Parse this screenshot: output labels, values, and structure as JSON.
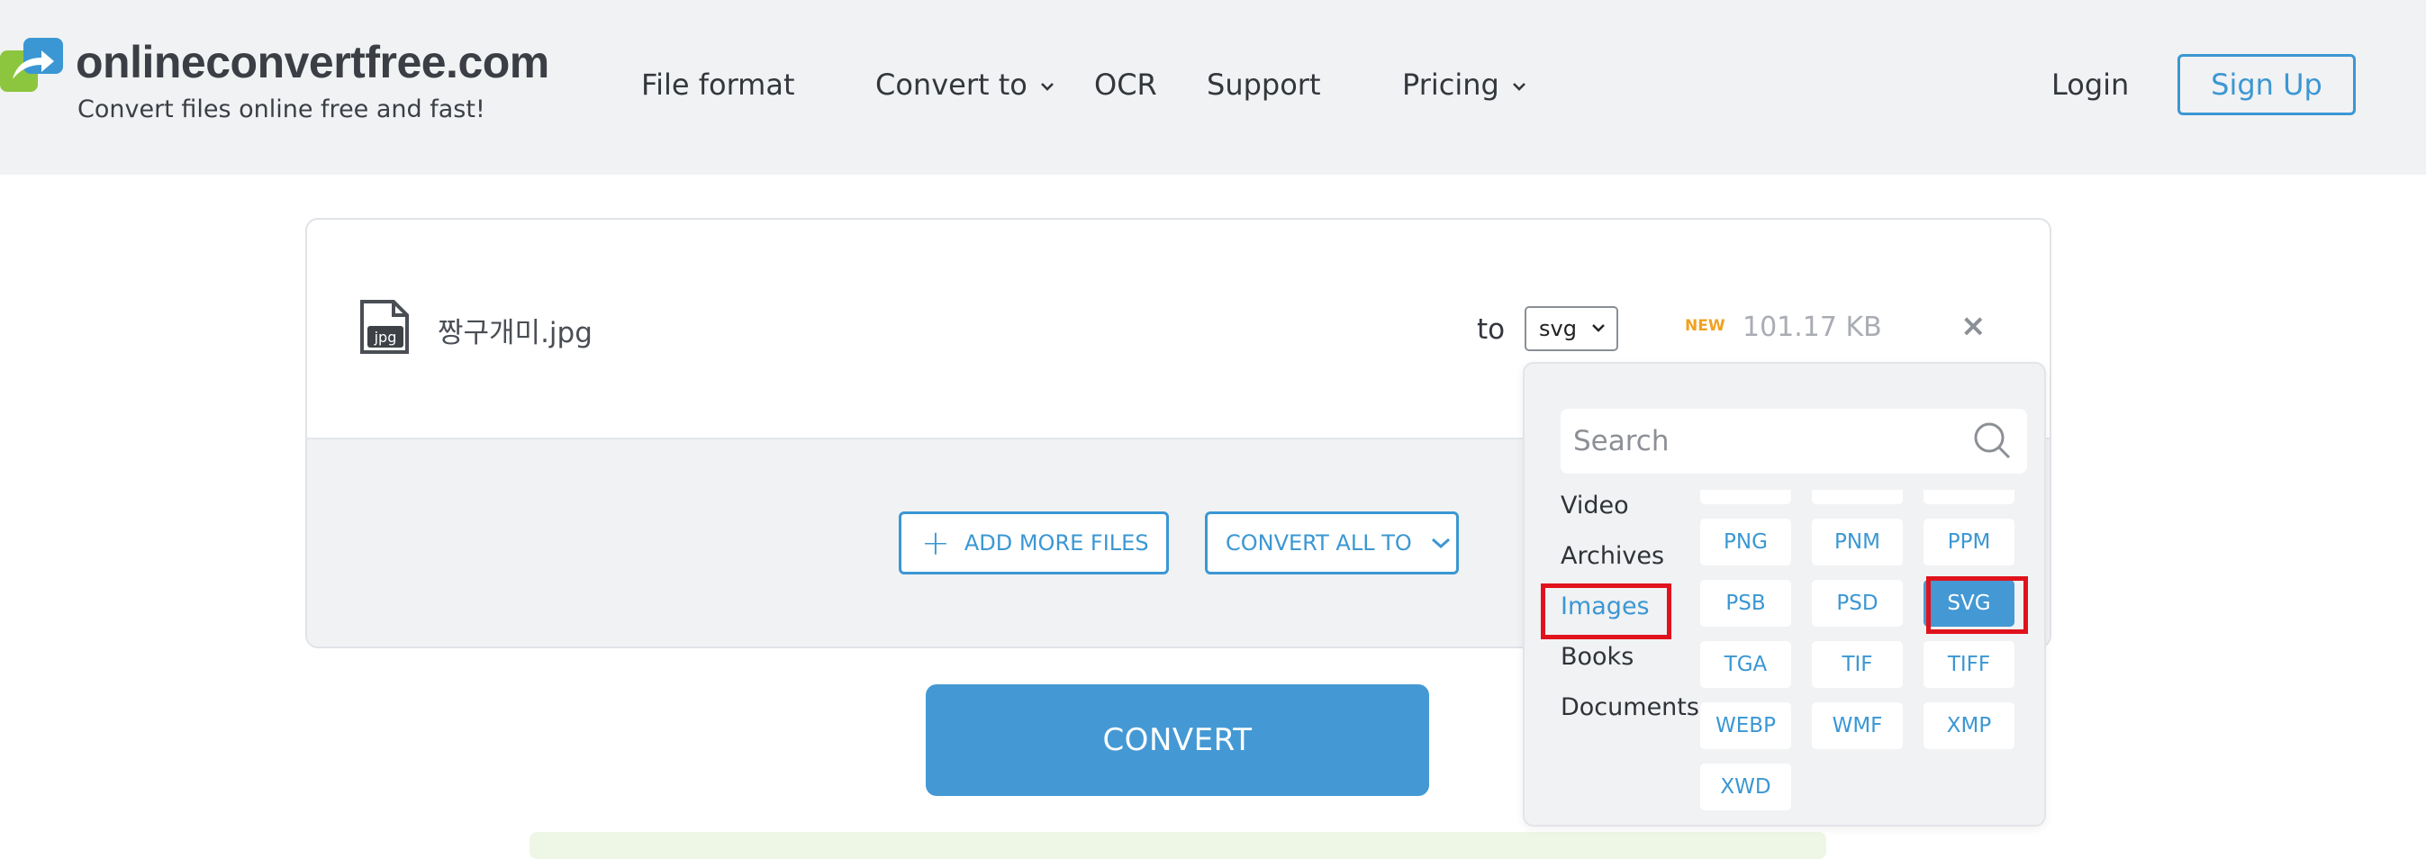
{
  "header": {
    "logo_title": "onlineconvertfree.com",
    "logo_subtitle": "Convert files online free and fast!",
    "nav": {
      "file_format": "File format",
      "convert_to": "Convert to",
      "ocr": "OCR",
      "support": "Support",
      "pricing": "Pricing"
    },
    "login": "Login",
    "signup": "Sign Up"
  },
  "file": {
    "icon_label": "jpg",
    "name": "짱구개미.jpg",
    "to_label": "to",
    "selected_format": "svg",
    "new_badge": "NEW",
    "size": "101.17 KB",
    "remove": "×"
  },
  "actions": {
    "add_more": "ADD MORE FILES",
    "convert_all": "CONVERT ALL TO",
    "convert": "CONVERT"
  },
  "dropdown": {
    "search_placeholder": "Search",
    "categories": [
      "Video",
      "Archives",
      "Images",
      "Books",
      "Documents"
    ],
    "active_category": "Images",
    "formats_row1": [
      "PNG",
      "PNM",
      "PPM"
    ],
    "formats_row2": [
      "PSB",
      "PSD",
      "SVG"
    ],
    "formats_row3": [
      "TGA",
      "TIF",
      "TIFF"
    ],
    "formats_row4": [
      "WEBP",
      "WMF",
      "XMP"
    ],
    "formats_row5": [
      "XWD"
    ],
    "selected_format": "SVG"
  },
  "colors": {
    "accent": "#4499d4",
    "highlight": "#e0131d",
    "new_badge": "#f0a220",
    "header_bg": "#f1f2f4"
  }
}
